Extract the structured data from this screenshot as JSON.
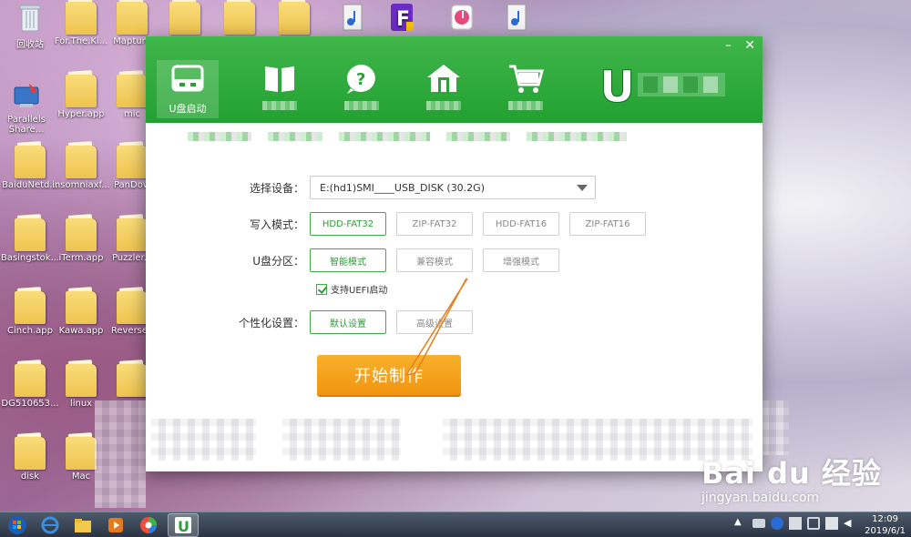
{
  "desktop": {
    "icons": [
      {
        "label": "回收站",
        "type": "recycle"
      },
      {
        "label": "For.The.Ki...",
        "type": "folder"
      },
      {
        "label": "Mapture",
        "type": "folder"
      },
      {
        "label": "",
        "type": "folder"
      },
      {
        "label": "",
        "type": "folder"
      },
      {
        "label": "",
        "type": "folder"
      },
      {
        "label": "Parallels Share...",
        "type": "parallels"
      },
      {
        "label": "Hyper.app",
        "type": "folder"
      },
      {
        "label": "mic",
        "type": "folder"
      },
      {
        "label": "BaiduNetd...",
        "type": "folder"
      },
      {
        "label": "insomniaxf...",
        "type": "folder"
      },
      {
        "label": "PanDow",
        "type": "folder"
      },
      {
        "label": "Basingstok...",
        "type": "folder"
      },
      {
        "label": "iTerm.app",
        "type": "folder"
      },
      {
        "label": "Puzzler.a",
        "type": "folder"
      },
      {
        "label": "Cinch.app",
        "type": "folder"
      },
      {
        "label": "Kawa.app",
        "type": "folder"
      },
      {
        "label": "ReverseT",
        "type": "folder"
      },
      {
        "label": "DG510653...",
        "type": "folder"
      },
      {
        "label": "linux",
        "type": "folder"
      },
      {
        "label": "disk",
        "type": "folder"
      },
      {
        "label": "Mac",
        "type": "folder"
      }
    ]
  },
  "window": {
    "controls": {
      "minimize": "–",
      "close": "✕"
    },
    "nav": [
      {
        "label": "U盘启动",
        "icon": "usb-drive-icon",
        "active": true
      },
      {
        "label": "",
        "icon": "book-icon"
      },
      {
        "label": "",
        "icon": "help-icon"
      },
      {
        "label": "",
        "icon": "home-icon"
      },
      {
        "label": "",
        "icon": "cart-icon"
      }
    ],
    "logo_letter": "U"
  },
  "form": {
    "device_label": "选择设备：",
    "device_value": "E:(hd1)SMI____USB_DISK (30.2G)",
    "write_mode_label": "写入模式：",
    "write_modes": [
      "HDD-FAT32",
      "ZIP-FAT32",
      "HDD-FAT16",
      "ZIP-FAT16"
    ],
    "write_mode_selected": "HDD-FAT32",
    "partition_label": "U盘分区：",
    "partition_modes": [
      "智能模式",
      "兼容模式",
      "增强模式"
    ],
    "uefi_label": "支持UEFI启动",
    "personal_label": "个性化设置：",
    "personal_options": [
      "默认设置",
      "高级设置"
    ],
    "start_label": "开始制作"
  },
  "taskbar": {
    "time": "12:09",
    "date": "2019/6/1"
  },
  "watermark": {
    "main": "Bai du 经验",
    "sub": "jingyan.baidu.com"
  },
  "colors": {
    "accent_green": "#2fa83b",
    "button_orange": "#f5a31d",
    "arrow_orange": "#e67e1e"
  }
}
